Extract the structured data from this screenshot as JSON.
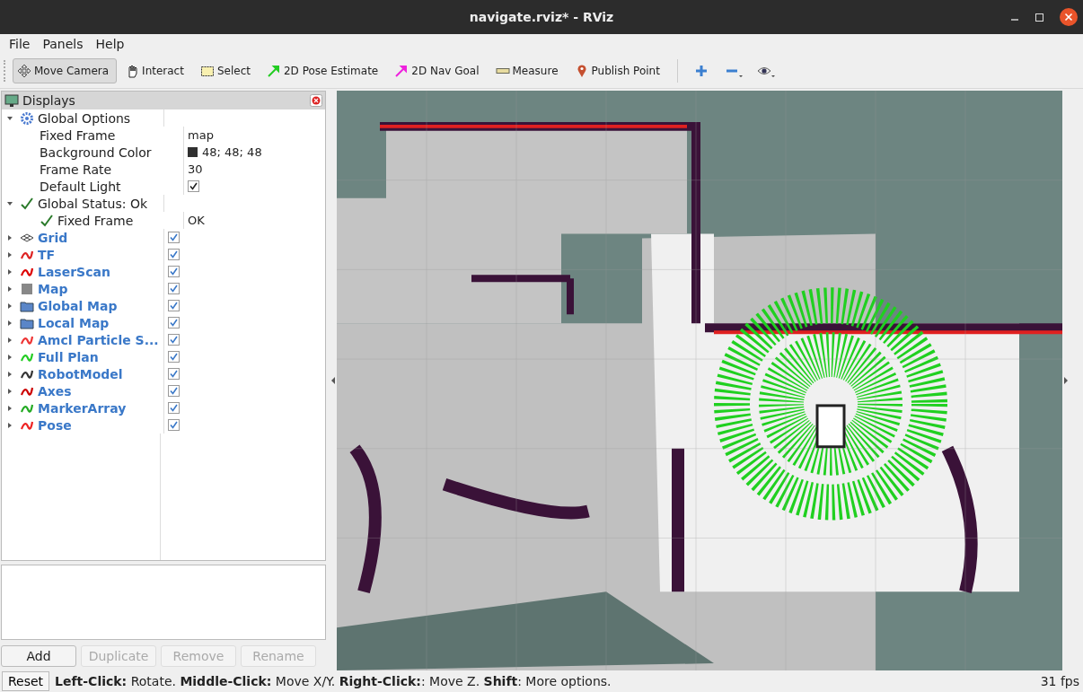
{
  "window": {
    "title": "navigate.rviz* - RViz"
  },
  "menu": [
    {
      "label": "File"
    },
    {
      "label": "Panels"
    },
    {
      "label": "Help"
    }
  ],
  "toolbar": {
    "tools": [
      {
        "label": "Move Camera",
        "selected": true
      },
      {
        "label": "Interact",
        "selected": false
      },
      {
        "label": "Select",
        "selected": false
      },
      {
        "label": "2D Pose Estimate",
        "selected": false
      },
      {
        "label": "2D Nav Goal",
        "selected": false
      },
      {
        "label": "Measure",
        "selected": false
      },
      {
        "label": "Publish Point",
        "selected": false
      }
    ]
  },
  "displays_panel": {
    "title": "Displays",
    "tree": [
      {
        "kind": "group",
        "label": "Global Options",
        "expanded": true,
        "children": [
          {
            "kind": "text",
            "label": "Fixed Frame",
            "value": "map"
          },
          {
            "kind": "color",
            "label": "Background Color",
            "value": "48; 48; 48"
          },
          {
            "kind": "text",
            "label": "Frame Rate",
            "value": "30"
          },
          {
            "kind": "check",
            "label": "Default Light",
            "checked": true
          }
        ]
      },
      {
        "kind": "status",
        "label": "Global Status: Ok",
        "expanded": true,
        "children": [
          {
            "kind": "status",
            "label": "Fixed Frame",
            "value": "OK"
          }
        ]
      },
      {
        "kind": "display",
        "label": "Grid",
        "expanded": false,
        "checked": true
      },
      {
        "kind": "display",
        "label": "TF",
        "expanded": false,
        "checked": true
      },
      {
        "kind": "display",
        "label": "LaserScan",
        "expanded": false,
        "checked": true
      },
      {
        "kind": "display",
        "label": "Map",
        "expanded": false,
        "checked": true
      },
      {
        "kind": "display",
        "label": "Global Map",
        "expanded": false,
        "checked": true
      },
      {
        "kind": "display",
        "label": "Local Map",
        "expanded": false,
        "checked": true
      },
      {
        "kind": "display",
        "label": "Amcl Particle S...",
        "expanded": false,
        "checked": true
      },
      {
        "kind": "display",
        "label": "Full Plan",
        "expanded": false,
        "checked": true
      },
      {
        "kind": "display",
        "label": "RobotModel",
        "expanded": false,
        "checked": true
      },
      {
        "kind": "display",
        "label": "Axes",
        "expanded": false,
        "checked": true
      },
      {
        "kind": "display",
        "label": "MarkerArray",
        "expanded": false,
        "checked": true
      },
      {
        "kind": "display",
        "label": "Pose",
        "expanded": false,
        "checked": true
      }
    ],
    "buttons": [
      {
        "label": "Add",
        "disabled": false
      },
      {
        "label": "Duplicate",
        "disabled": true
      },
      {
        "label": "Remove",
        "disabled": true
      },
      {
        "label": "Rename",
        "disabled": true
      }
    ]
  },
  "status_bar": {
    "reset": "Reset",
    "help": "**Left-Click:** Rotate. **Middle-Click:** Move X/Y. **Right-Click:**: Move Z. **Shift**: More options.",
    "fps": "31 fps"
  }
}
